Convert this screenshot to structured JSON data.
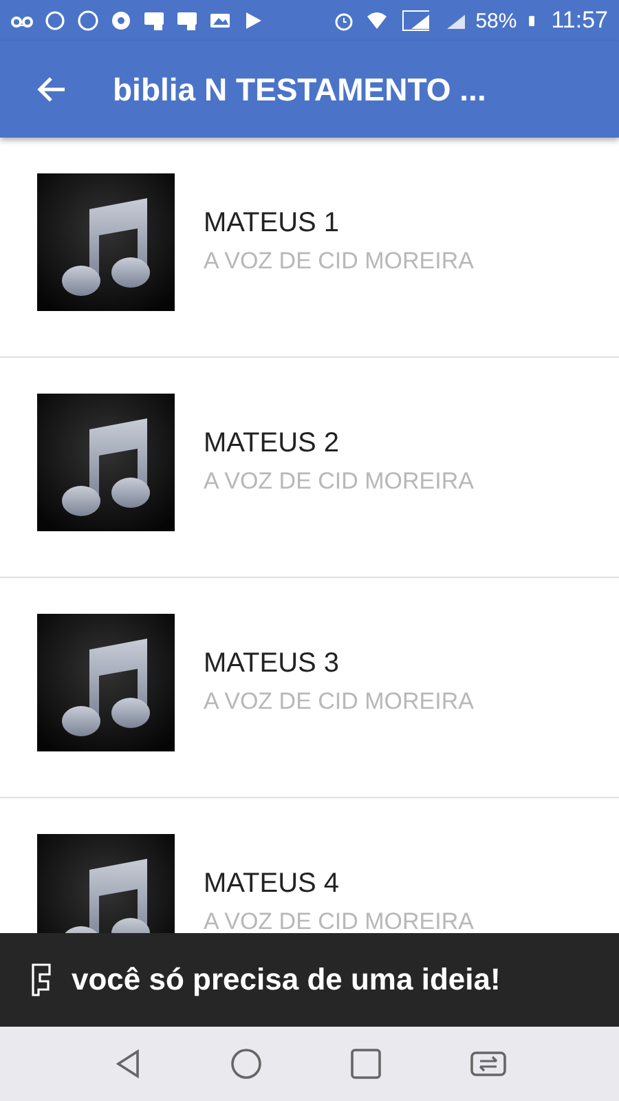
{
  "status_bar": {
    "battery": "58%",
    "time": "11:57"
  },
  "app_bar": {
    "title": "biblia N TESTAMENTO ..."
  },
  "tracks": [
    {
      "title": "MATEUS 1",
      "subtitle": "A VOZ DE CID MOREIRA"
    },
    {
      "title": "MATEUS 2",
      "subtitle": "A VOZ DE CID MOREIRA"
    },
    {
      "title": "MATEUS 3",
      "subtitle": "A VOZ DE CID MOREIRA"
    },
    {
      "title": "MATEUS 4",
      "subtitle": "A VOZ DE CID MOREIRA"
    }
  ],
  "banner": {
    "text": "você só precisa de uma ideia!"
  }
}
